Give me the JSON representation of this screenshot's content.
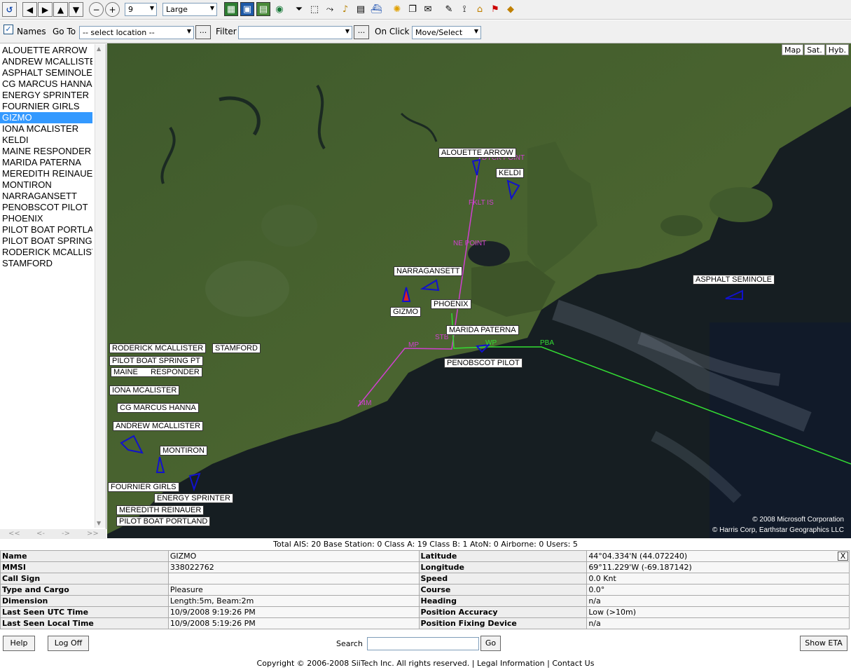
{
  "toolbar": {
    "zoom_value": "9",
    "size_value": "Large",
    "icons": [
      "refresh-icon",
      "pan-left-icon",
      "pan-right-icon",
      "pan-up-icon",
      "pan-down-icon",
      "zoom-out-icon",
      "zoom-in-icon",
      "map-view-icon",
      "satellite-view-icon",
      "hybrid-view-icon",
      "globe-icon",
      "filter-icon",
      "select-area-icon",
      "track-icon",
      "alarm-icon",
      "export-icon",
      "ship-icon",
      "weather-icon",
      "layers-icon",
      "message-icon",
      "edit-icon",
      "route-icon",
      "folder-icon",
      "flag-icon",
      "warning-icon"
    ]
  },
  "controls": {
    "names_label": "Names",
    "names_checked": true,
    "goto_label": "Go To",
    "goto_value": "-- select location --",
    "goto_more": "...",
    "filter_label": "Filter",
    "filter_value": "",
    "filter_more": "...",
    "onclick_label": "On Click",
    "onclick_value": "Move/Select"
  },
  "vessel_list": {
    "items": [
      "ALOUETTE ARROW",
      "ANDREW MCALLISTER",
      "ASPHALT SEMINOLE",
      "CG MARCUS HANNA",
      "ENERGY SPRINTER",
      "FOURNIER GIRLS",
      "GIZMO",
      "IONA MCALISTER",
      "KELDI",
      "MAINE RESPONDER",
      "MARIDA PATERNA",
      "MEREDITH REINAUER",
      "MONTIRON",
      "NARRAGANSETT",
      "PENOBSCOT PILOT",
      "PHOENIX",
      "PILOT BOAT PORTLAND",
      "PILOT BOAT SPRING",
      "RODERICK MCALLISTER",
      "STAMFORD"
    ],
    "selected_index": 6,
    "pager": [
      "<<",
      "<-",
      "->",
      ">>"
    ]
  },
  "map": {
    "type_buttons": [
      "Map",
      "Sat.",
      "Hyb."
    ],
    "copyright_1": "© 2008 Microsoft Corporation",
    "copyright_2": "© Harris Corp, Earthstar Geographics LLC",
    "vessel_labels": [
      "ALOUETTE ARROW",
      "KELDI",
      "NARRAGANSETT",
      "GIZMO",
      "PHOENIX",
      "MARIDA PATERNA",
      "PENOBSCOT PILOT",
      "ASPHALT SEMINOLE",
      "RODERICK MCALLISTER",
      "STAMFORD",
      "PILOT BOAT SPRING PT",
      "MAINE      RESPONDER",
      "IONA MCALISTER",
      "CG MARCUS HANNA",
      "ANDREW MCALLISTER",
      "MONTIRON",
      "FOURNIER GIRLS",
      "ENERGY SPRINTER",
      "MEREDITH REINAUER",
      "PILOT BOAT PORTLAND"
    ],
    "path_labels": [
      "DYCK POINT",
      "FKLT IS",
      "NE POINT",
      "MP",
      "STB",
      "14M",
      "WP",
      "PBA"
    ],
    "colors": {
      "magenta_route": "#d040d0",
      "green_route": "#33dd33",
      "vessel": "#1111cc",
      "selected_vessel": "#dd2222"
    }
  },
  "summary": "Total AIS: 20 Base Station: 0 Class A: 19 Class B: 1 AtoN: 0 Airborne: 0 Users: 5",
  "details": {
    "rows": [
      {
        "k1": "Name",
        "v1": "GIZMO",
        "k2": "Latitude",
        "v2": "44°04.334'N (44.072240)"
      },
      {
        "k1": "MMSI",
        "v1": "338022762",
        "k2": "Longitude",
        "v2": "69°11.229'W (-69.187142)"
      },
      {
        "k1": "Call Sign",
        "v1": "",
        "k2": "Speed",
        "v2": "0.0 Knt"
      },
      {
        "k1": "Type and Cargo",
        "v1": "Pleasure",
        "k2": "Course",
        "v2": "0.0°"
      },
      {
        "k1": "Dimension",
        "v1": "Length:5m, Beam:2m",
        "k2": "Heading",
        "v2": "n/a"
      },
      {
        "k1": "Last Seen UTC Time",
        "v1": "10/9/2008 9:19:26 PM",
        "k2": "Position Accuracy",
        "v2": "Low (>10m)"
      },
      {
        "k1": "Last Seen Local Time",
        "v1": "10/9/2008 5:19:26 PM",
        "k2": "Position Fixing Device",
        "v2": "n/a"
      }
    ],
    "close": "X"
  },
  "bottom": {
    "help": "Help",
    "logoff": "Log Off",
    "search_label": "Search",
    "search_value": "",
    "go": "Go",
    "show_eta": "Show ETA"
  },
  "footer": {
    "copyright": "Copyright © 2006-2008 SiiTech Inc. All rights reserved.",
    "sep": "|",
    "legal": "Legal Information",
    "contact": "Contact Us"
  }
}
